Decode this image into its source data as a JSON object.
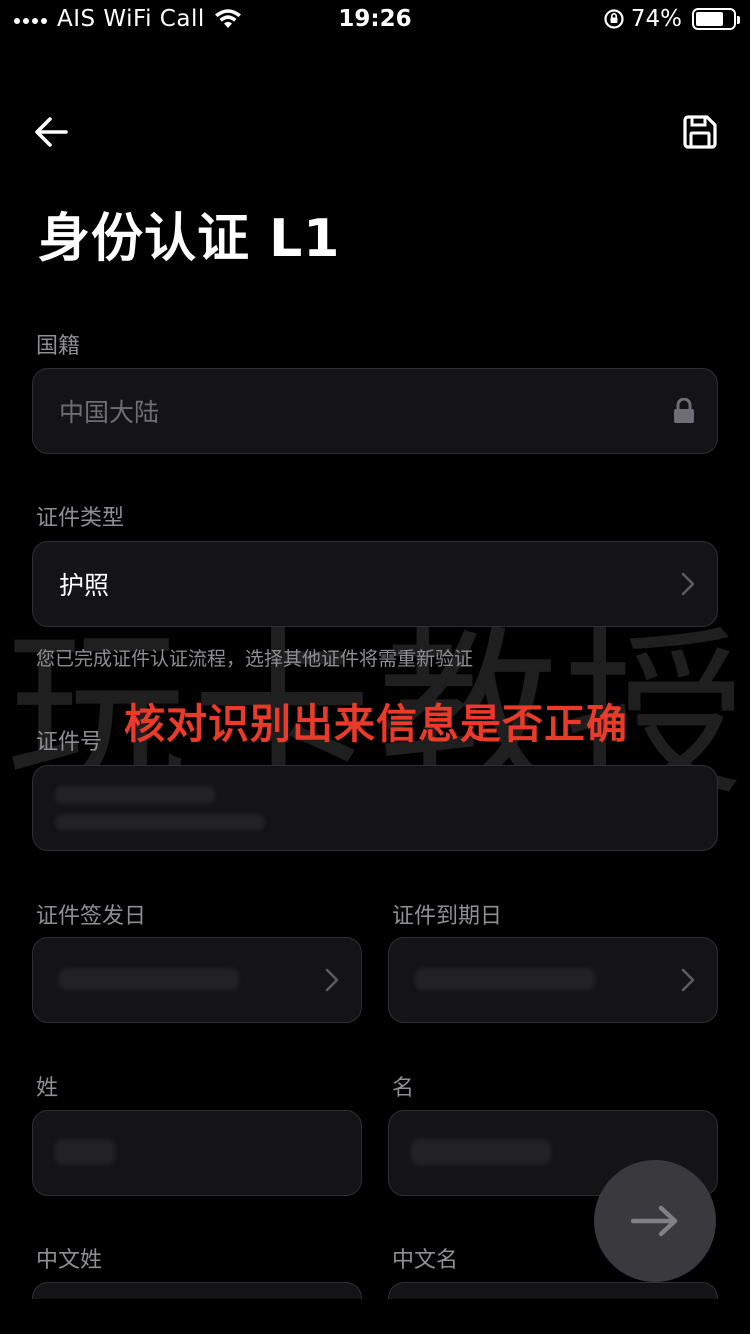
{
  "status_bar": {
    "carrier": "AIS WiFi Call",
    "time": "19:26",
    "battery_pct": "74%",
    "battery_level": 0.74
  },
  "header": {
    "title": "身份认证 L1"
  },
  "form": {
    "nationality": {
      "label": "国籍",
      "value": "中国大陆"
    },
    "id_type": {
      "label": "证件类型",
      "value": "护照"
    },
    "hint": "您已完成证件认证流程，选择其他证件将需重新验证",
    "id_number": {
      "label": "证件号"
    },
    "issue_date": {
      "label": "证件签发日"
    },
    "expiry_date": {
      "label": "证件到期日"
    },
    "surname": {
      "label": "姓"
    },
    "given_name": {
      "label": "名"
    },
    "cn_surname": {
      "label": "中文姓"
    },
    "cn_given_name": {
      "label": "中文名"
    }
  },
  "watermark": "玩卡教授",
  "overlay": "核对识别出来信息是否正确",
  "icons": [
    "back-arrow-icon",
    "save-icon",
    "lock-icon",
    "chevron-right-icon",
    "arrow-right-icon",
    "wifi-icon"
  ]
}
